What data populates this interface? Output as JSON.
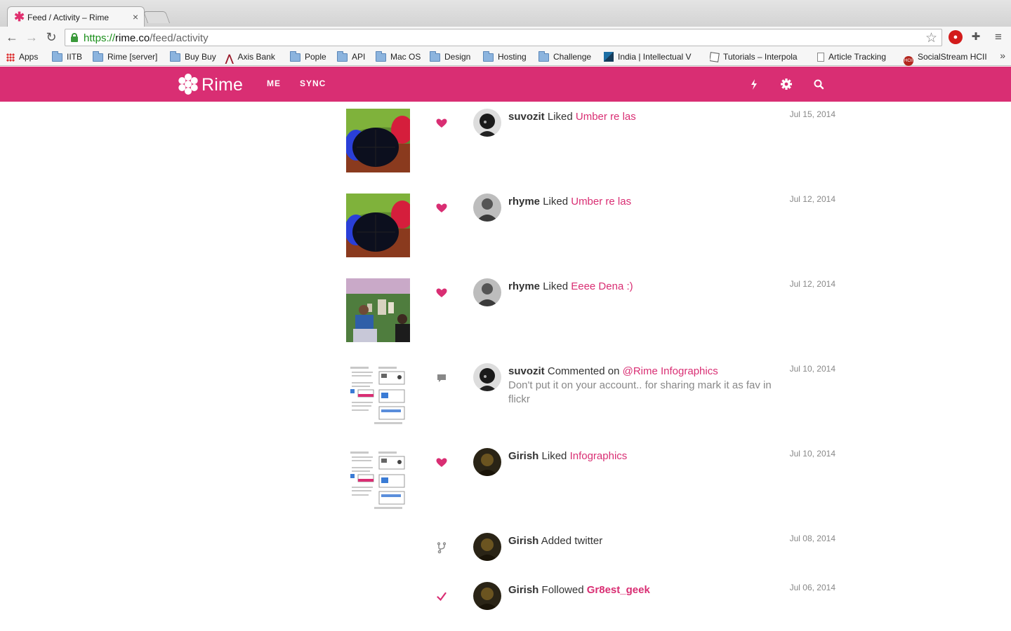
{
  "browser": {
    "tab_title": "Feed / Activity – Rime",
    "url_scheme": "https://",
    "url_host": "rime.co",
    "url_path": "/feed/activity",
    "bookmarks": [
      {
        "label": "Apps",
        "icon": "apps-grid-icon"
      },
      {
        "label": "IITB",
        "icon": "folder-icon"
      },
      {
        "label": "Rime [server]",
        "icon": "folder-icon"
      },
      {
        "label": "Buy Buy",
        "icon": "folder-icon"
      },
      {
        "label": "Axis Bank",
        "icon": "axis-bank-icon"
      },
      {
        "label": "Pople",
        "icon": "folder-icon"
      },
      {
        "label": "API",
        "icon": "folder-icon"
      },
      {
        "label": "Mac OS",
        "icon": "folder-icon"
      },
      {
        "label": "Design",
        "icon": "folder-icon"
      },
      {
        "label": "Hosting",
        "icon": "folder-icon"
      },
      {
        "label": "Challenge",
        "icon": "folder-icon"
      },
      {
        "label": "India | Intellectual V",
        "icon": "site-icon"
      },
      {
        "label": "Tutorials – Interpola",
        "icon": "site-icon"
      },
      {
        "label": "Article Tracking",
        "icon": "document-icon"
      },
      {
        "label": "SocialStream HCII",
        "icon": "site-icon"
      }
    ],
    "more_bookmarks": "»"
  },
  "app": {
    "brand": "Rime",
    "brand_color": "#d92e73",
    "nav": [
      "ME",
      "SYNC"
    ],
    "header_icons": [
      "bolt-icon",
      "gear-icon",
      "search-icon"
    ]
  },
  "feed": [
    {
      "user": "suvozit",
      "action": "Liked",
      "target": "Umber re las",
      "date": "Jul 15, 2014",
      "type": "like",
      "thumb": "umbrellas"
    },
    {
      "user": "rhyme",
      "action": "Liked",
      "target": "Umber re las",
      "date": "Jul 12, 2014",
      "type": "like",
      "thumb": "umbrellas"
    },
    {
      "user": "rhyme",
      "action": "Liked",
      "target": "Eeee Dena :)",
      "date": "Jul 12, 2014",
      "type": "like",
      "thumb": "city-photo"
    },
    {
      "user": "suvozit",
      "action": "Commented on",
      "target": "@Rime Infographics",
      "comment": "Don't put it on your account.. for sharing mark it as fav in flickr",
      "date": "Jul 10, 2014",
      "type": "comment",
      "thumb": "infographic"
    },
    {
      "user": "Girish",
      "action": "Liked",
      "target": "Infographics",
      "date": "Jul 10, 2014",
      "type": "like",
      "thumb": "infographic"
    },
    {
      "user": "Girish",
      "action": "Added twitter",
      "target": "",
      "date": "Jul 08, 2014",
      "type": "sync"
    },
    {
      "user": "Girish",
      "action": "Followed",
      "target": "Gr8est_geek",
      "date": "Jul 06, 2014",
      "type": "follow"
    }
  ]
}
